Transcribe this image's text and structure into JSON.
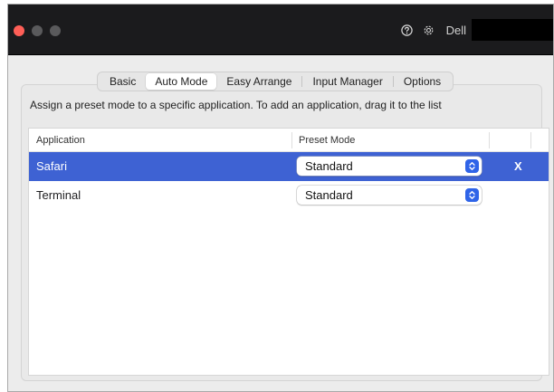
{
  "titlebar": {
    "brand_label": "Dell"
  },
  "tabs": [
    {
      "label": "Basic"
    },
    {
      "label": "Auto Mode",
      "active": true
    },
    {
      "label": "Easy Arrange"
    },
    {
      "label": "Input Manager"
    },
    {
      "label": "Options"
    }
  ],
  "instruction": "Assign a preset mode to a specific application.  To add an application, drag it to the list",
  "table": {
    "columns": [
      "Application",
      "Preset Mode"
    ],
    "rows": [
      {
        "application": "Safari",
        "preset_mode": "Standard",
        "selected": true,
        "remove_label": "X"
      },
      {
        "application": "Terminal",
        "preset_mode": "Standard",
        "selected": false
      }
    ]
  },
  "colors": {
    "selection": "#3e62d3",
    "stepper": "#2f64e8",
    "titlebar": "#1b1b1d",
    "close_button": "#ff5f57"
  },
  "icons": [
    "help-icon",
    "gear-icon",
    "stepper-icon"
  ]
}
